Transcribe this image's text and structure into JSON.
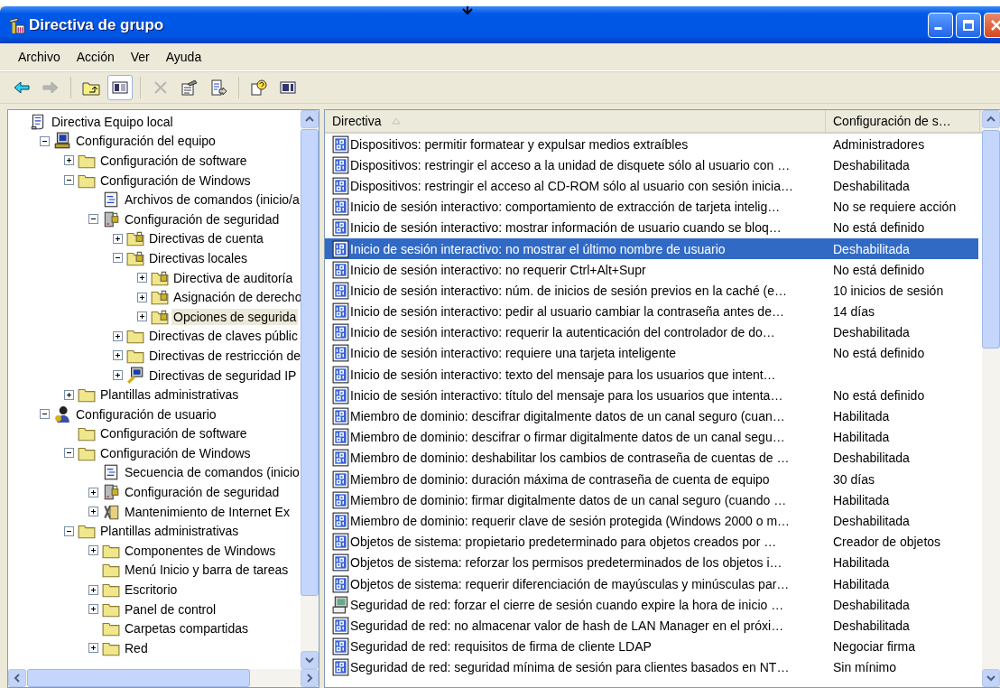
{
  "window": {
    "title": "Directiva de grupo"
  },
  "menu": [
    "Archivo",
    "Acción",
    "Ver",
    "Ayuda"
  ],
  "toolbar": [
    {
      "kind": "back",
      "disabled": false,
      "pressed": false
    },
    {
      "kind": "forward",
      "disabled": true,
      "pressed": false
    },
    {
      "kind": "sep"
    },
    {
      "kind": "up",
      "disabled": false,
      "pressed": false
    },
    {
      "kind": "tree",
      "disabled": false,
      "pressed": true
    },
    {
      "kind": "sep"
    },
    {
      "kind": "delete",
      "disabled": true,
      "pressed": false
    },
    {
      "kind": "properties",
      "disabled": false,
      "pressed": false
    },
    {
      "kind": "export",
      "disabled": false,
      "pressed": false
    },
    {
      "kind": "sep"
    },
    {
      "kind": "help",
      "disabled": false,
      "pressed": false
    },
    {
      "kind": "pane",
      "disabled": false,
      "pressed": false
    }
  ],
  "tree": [
    {
      "label": "Directiva Equipo local",
      "kind": "scroll",
      "selected": false,
      "children": [
        {
          "label": "Configuración del equipo",
          "kind": "computer",
          "expanded": true,
          "selected": false,
          "children": [
            {
              "label": "Configuración de software",
              "kind": "folder",
              "expanded": false,
              "selected": false
            },
            {
              "label": "Configuración de Windows",
              "kind": "folder",
              "expanded": true,
              "selected": false,
              "children": [
                {
                  "label": "Archivos de comandos (inicio/a",
                  "kind": "script",
                  "selected": false
                },
                {
                  "label": "Configuración de seguridad",
                  "kind": "security",
                  "expanded": true,
                  "selected": false,
                  "children": [
                    {
                      "label": "Directivas de cuenta",
                      "kind": "lockfolder",
                      "expanded": false,
                      "selected": false
                    },
                    {
                      "label": "Directivas locales",
                      "kind": "lockfolder",
                      "expanded": true,
                      "selected": false,
                      "children": [
                        {
                          "label": "Directiva de auditoría",
                          "kind": "lockfolder",
                          "expanded": false,
                          "selected": false
                        },
                        {
                          "label": "Asignación de derecho",
                          "kind": "lockfolder",
                          "expanded": false,
                          "selected": false
                        },
                        {
                          "label": "Opciones de segurida",
                          "kind": "lockfolder",
                          "expanded": false,
                          "selected": true
                        }
                      ]
                    },
                    {
                      "label": "Directivas de claves públic",
                      "kind": "folder",
                      "expanded": false,
                      "selected": false
                    },
                    {
                      "label": "Directivas de restricción de",
                      "kind": "folder",
                      "expanded": false,
                      "selected": false
                    },
                    {
                      "label": "Directivas de seguridad IP",
                      "kind": "ipsec",
                      "expanded": false,
                      "selected": false
                    }
                  ]
                }
              ]
            },
            {
              "label": "Plantillas administrativas",
              "kind": "folder",
              "expanded": false,
              "selected": false
            }
          ]
        },
        {
          "label": "Configuración de usuario",
          "kind": "user",
          "expanded": true,
          "selected": false,
          "children": [
            {
              "label": "Configuración de software",
              "kind": "folder",
              "selected": false
            },
            {
              "label": "Configuración de Windows",
              "kind": "folder",
              "expanded": true,
              "selected": false,
              "children": [
                {
                  "label": "Secuencia de comandos (inicio",
                  "kind": "script",
                  "selected": false
                },
                {
                  "label": "Configuración de seguridad",
                  "kind": "security",
                  "expanded": false,
                  "selected": false
                },
                {
                  "label": "Mantenimiento de Internet Ex",
                  "kind": "iemaint",
                  "expanded": false,
                  "selected": false
                }
              ]
            },
            {
              "label": "Plantillas administrativas",
              "kind": "folder",
              "expanded": true,
              "selected": false,
              "children": [
                {
                  "label": "Componentes de Windows",
                  "kind": "folder",
                  "expanded": false,
                  "selected": false
                },
                {
                  "label": "Menú Inicio y barra de tareas",
                  "kind": "folder",
                  "selected": false
                },
                {
                  "label": "Escritorio",
                  "kind": "folder",
                  "expanded": false,
                  "selected": false
                },
                {
                  "label": "Panel de control",
                  "kind": "folder",
                  "expanded": false,
                  "selected": false
                },
                {
                  "label": "Carpetas compartidas",
                  "kind": "folder",
                  "selected": false
                },
                {
                  "label": "Red",
                  "kind": "folder",
                  "expanded": false,
                  "selected": false
                }
              ]
            }
          ]
        }
      ]
    }
  ],
  "table": {
    "columns": [
      "Directiva",
      "Configuración de s…"
    ],
    "rows": [
      {
        "kind": "policy",
        "policy": "Dispositivos: permitir formatear y expulsar medios extraíbles",
        "setting": "Administradores",
        "selected": false
      },
      {
        "kind": "policy",
        "policy": "Dispositivos: restringir el acceso a la unidad de disquete sólo al usuario con …",
        "setting": "Deshabilitada",
        "selected": false
      },
      {
        "kind": "policy",
        "policy": "Dispositivos: restringir el acceso al CD-ROM sólo al usuario con sesión inicia…",
        "setting": "Deshabilitada",
        "selected": false
      },
      {
        "kind": "policy",
        "policy": "Inicio de sesión interactivo: comportamiento de extracción de tarjeta intelig…",
        "setting": "No se requiere acción",
        "selected": false
      },
      {
        "kind": "policy",
        "policy": "Inicio de sesión interactivo: mostrar información de usuario cuando se bloq…",
        "setting": "No está definido",
        "selected": false
      },
      {
        "kind": "policy",
        "policy": "Inicio de sesión interactivo: no mostrar el último nombre de usuario",
        "setting": "Deshabilitada",
        "selected": true
      },
      {
        "kind": "policy",
        "policy": "Inicio de sesión interactivo: no requerir Ctrl+Alt+Supr",
        "setting": "No está definido",
        "selected": false
      },
      {
        "kind": "policy",
        "policy": "Inicio de sesión interactivo: núm. de inicios de sesión previos en la caché (e…",
        "setting": "10 inicios de sesión",
        "selected": false
      },
      {
        "kind": "policy",
        "policy": "Inicio de sesión interactivo: pedir al usuario cambiar la contraseña antes de…",
        "setting": "14 días",
        "selected": false
      },
      {
        "kind": "policy",
        "policy": "Inicio de sesión interactivo: requerir la autenticación del controlador de do…",
        "setting": "Deshabilitada",
        "selected": false
      },
      {
        "kind": "policy",
        "policy": "Inicio de sesión interactivo: requiere una tarjeta inteligente",
        "setting": "No está definido",
        "selected": false
      },
      {
        "kind": "policy",
        "policy": "Inicio de sesión interactivo: texto del mensaje para los usuarios que intent…",
        "selected": false
      },
      {
        "kind": "policy",
        "policy": "Inicio de sesión interactivo: título del mensaje para los usuarios que intenta…",
        "setting": "No está definido",
        "selected": false
      },
      {
        "kind": "policy",
        "policy": "Miembro de dominio: descifrar digitalmente datos de un canal seguro (cuan…",
        "setting": "Habilitada",
        "selected": false
      },
      {
        "kind": "policy",
        "policy": "Miembro de dominio: descifrar o firmar digitalmente datos de un canal segu…",
        "setting": "Habilitada",
        "selected": false
      },
      {
        "kind": "policy",
        "policy": "Miembro de dominio: deshabilitar los cambios de contraseña de cuentas de …",
        "setting": "Deshabilitada",
        "selected": false
      },
      {
        "kind": "policy",
        "policy": "Miembro de dominio: duración máxima de contraseña de cuenta de equipo",
        "setting": "30 días",
        "selected": false
      },
      {
        "kind": "policy",
        "policy": "Miembro de dominio: firmar digitalmente datos de un canal seguro (cuando …",
        "setting": "Habilitada",
        "selected": false
      },
      {
        "kind": "policy",
        "policy": "Miembro de dominio: requerir clave de sesión protegida (Windows 2000 o m…",
        "setting": "Deshabilitada",
        "selected": false
      },
      {
        "kind": "policy",
        "policy": "Objetos de sistema: propietario predeterminado para objetos creados por …",
        "setting": "Creador de objetos",
        "selected": false
      },
      {
        "kind": "policy",
        "policy": "Objetos de sistema: reforzar los permisos predeterminados de los objetos i…",
        "setting": "Habilitada",
        "selected": false
      },
      {
        "kind": "policy",
        "policy": "Objetos de sistema: requerir diferenciación de mayúsculas y minúsculas par…",
        "setting": "Habilitada",
        "selected": false
      },
      {
        "kind": "network",
        "policy": "Seguridad de red: forzar el cierre de sesión cuando expire la hora de inicio …",
        "setting": "Deshabilitada",
        "selected": false
      },
      {
        "kind": "policy",
        "policy": "Seguridad de red: no almacenar valor de hash de LAN Manager en el próxi…",
        "setting": "Deshabilitada",
        "selected": false
      },
      {
        "kind": "policy",
        "policy": "Seguridad de red: requisitos de firma de cliente LDAP",
        "setting": "Negociar firma",
        "selected": false
      },
      {
        "kind": "policy",
        "policy": "Seguridad de red: seguridad mínima de sesión para clientes basados en NT…",
        "setting": "Sin mínimo",
        "selected": false
      }
    ]
  }
}
